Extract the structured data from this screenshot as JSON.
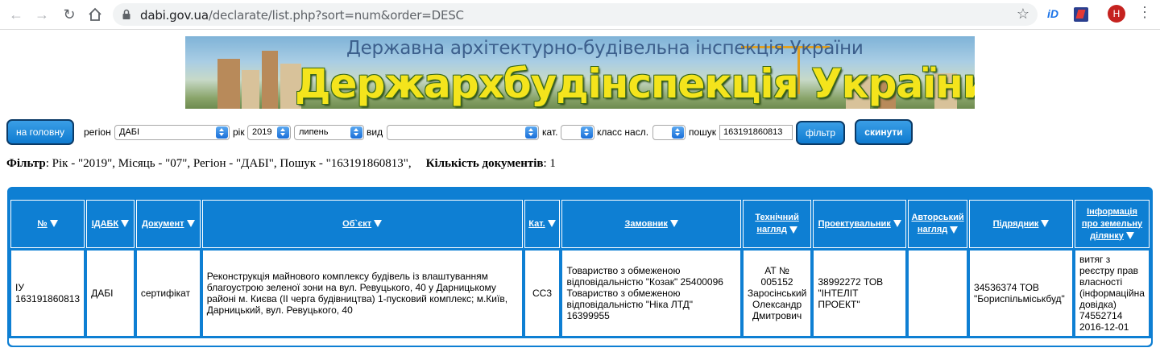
{
  "browser": {
    "url_host": "dabi.gov.ua",
    "url_rest": "/declarate/list.php?sort=num&order=DESC",
    "avatar_letter": "H",
    "ext_label": "iD"
  },
  "banner": {
    "subtitle": "Державна архітектурно-будівельна інспекція України",
    "title": "Держархбудінспекція України"
  },
  "toolbar": {
    "home_label": "на головну",
    "region_label": "регіон",
    "region_value": "ДАБІ",
    "year_label": "рік",
    "year_value": "2019",
    "month_value": "липень",
    "type_label": "вид",
    "type_value": "",
    "cat_label": "кат.",
    "cat_value": "",
    "class_label": "класс насл.",
    "class_value": "",
    "search_label": "пошук",
    "search_value": "163191860813",
    "filter_label": "фільтр",
    "reset_label": "скинути"
  },
  "summary": {
    "filter_label": "Фільтр",
    "filter_text": ": Рік - \"2019\", Місяць - \"07\", Регіон - \"ДАБІ\", Пошук - \"163191860813\",",
    "count_label": "Кількість документів",
    "count_text": ": 1"
  },
  "table": {
    "headers": [
      {
        "line1": "№",
        "line2": ""
      },
      {
        "line1": "ІДАБК",
        "line2": ""
      },
      {
        "line1": "Документ",
        "line2": ""
      },
      {
        "line1": "Об`єкт",
        "line2": ""
      },
      {
        "line1": "Кат.",
        "line2": ""
      },
      {
        "line1": "Замовник",
        "line2": ""
      },
      {
        "line1": "Технічний",
        "line2": "нагляд"
      },
      {
        "line1": "Проектувальник",
        "line2": ""
      },
      {
        "line1": "Авторський",
        "line2": "нагляд"
      },
      {
        "line1": "Підрядник",
        "line2": ""
      },
      {
        "line1": "Інформація про земельну",
        "line2": "ділянку"
      }
    ],
    "rows": [
      {
        "num": "ІУ 163191860813",
        "idabk": "ДАБІ",
        "document": "сертифікат",
        "object": "Реконструкція майнового комплексу будівель із влаштуванням благоустрою зеленої зони на вул. Ревуцького, 40 у Дарницькому районі м. Києва (ІІ черга будівництва) 1-пусковий комплекс; м.Київ, Дарницький, вул. Ревуцького, 40",
        "category": "СС3",
        "customer": "Товариство з обмеженою відповідальністю \"Козак\" 25400096 Товариство з обмеженою відповідальністю \"Ніка ЛТД\" 16399955",
        "tech_supervision": "АТ № 005152 Заросінський Олександр Дмитрович",
        "designer": "38992272 ТОВ \"ІНТЕЛІТ ПРОЕКТ\"",
        "author_supervision": "",
        "contractor": "34536374 ТОВ \"Бориспільміськбуд\"",
        "land_info": "витяг з реєстру прав власності (інформаційна довідка) 74552714 2016-12-01"
      }
    ]
  }
}
